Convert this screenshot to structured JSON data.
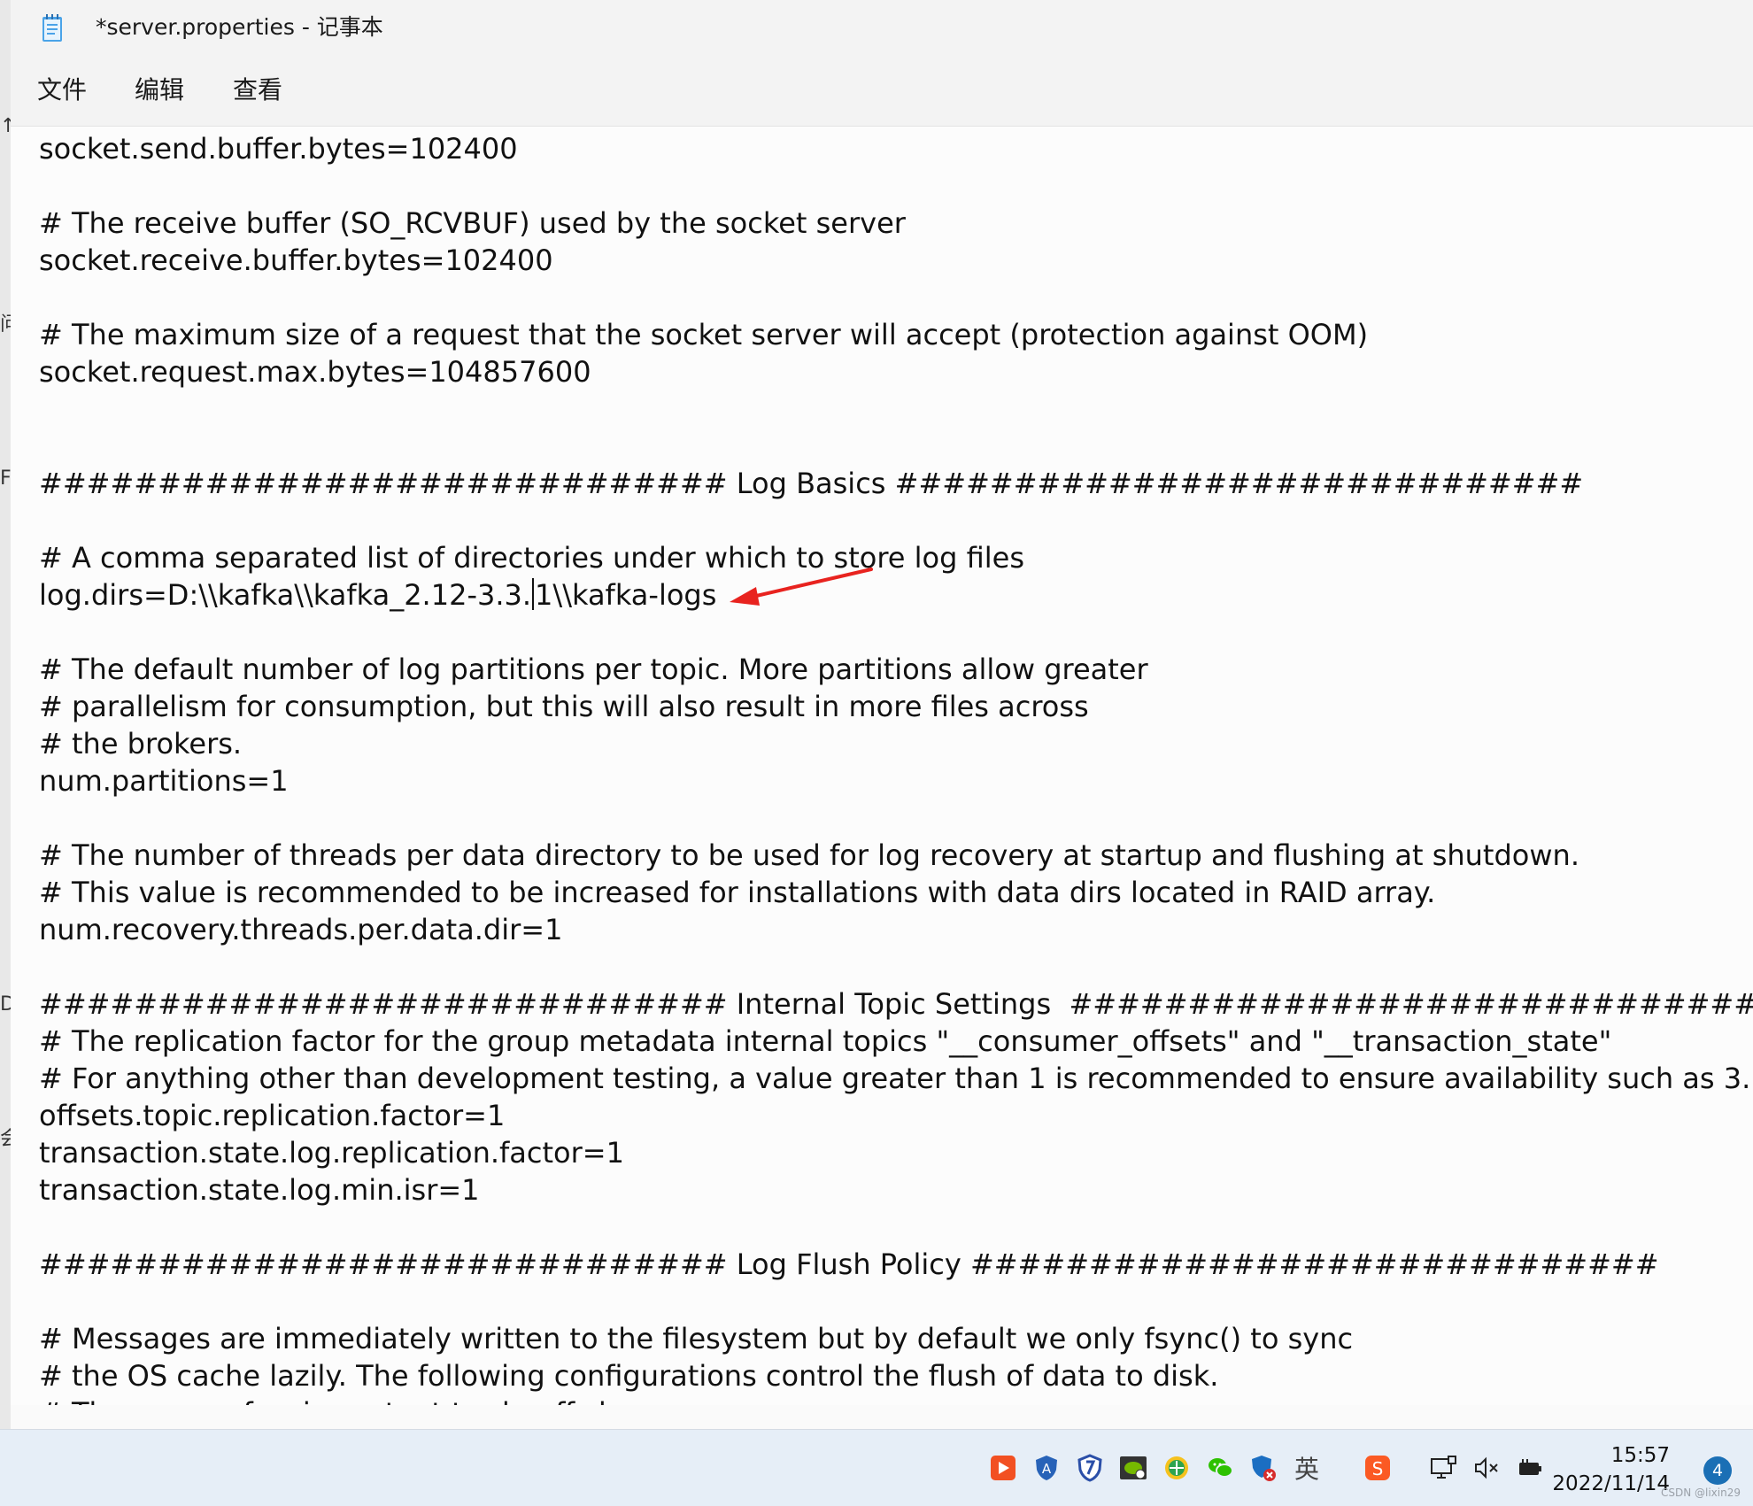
{
  "window": {
    "title": "*server.properties - 记事本"
  },
  "menu": {
    "file": "文件",
    "edit": "编辑",
    "view": "查看"
  },
  "left_strip": {
    "chars": [
      "↑",
      "问",
      "F",
      "D",
      "会"
    ]
  },
  "editor": {
    "lines": [
      "socket.send.buffer.bytes=102400",
      "",
      "# The receive buffer (SO_RCVBUF) used by the socket server",
      "socket.receive.buffer.bytes=102400",
      "",
      "# The maximum size of a request that the socket server will accept (protection against OOM)",
      "socket.request.max.bytes=104857600",
      "",
      "",
      "############################# Log Basics #############################",
      "",
      "# A comma separated list of directories under which to store log files",
      "",
      "",
      "# The default number of log partitions per topic. More partitions allow greater",
      "# parallelism for consumption, but this will also result in more files across",
      "# the brokers.",
      "num.partitions=1",
      "",
      "# The number of threads per data directory to be used for log recovery at startup and flushing at shutdown.",
      "# This value is recommended to be increased for installations with data dirs located in RAID array.",
      "num.recovery.threads.per.data.dir=1",
      "",
      "############################# Internal Topic Settings  #############################",
      "# The replication factor for the group metadata internal topics \"__consumer_offsets\" and \"__transaction_state\"",
      "# For anything other than development testing, a value greater than 1 is recommended to ensure availability such as 3.",
      "offsets.topic.replication.factor=1",
      "transaction.state.log.replication.factor=1",
      "transaction.state.log.min.isr=1",
      "",
      "############################# Log Flush Policy #############################",
      "",
      "# Messages are immediately written to the filesystem but by default we only fsync() to sync",
      "# the OS cache lazily. The following configurations control the flush of data to disk.",
      "# There are a few important trade-offs here:"
    ],
    "log_dirs_before_caret": "log.dirs=D:\\\\kafka\\\\kafka_2.12-3.3.",
    "log_dirs_after_caret": "1\\\\kafka-logs"
  },
  "annotation": {
    "arrow_color": "#e8231f"
  },
  "taskbar": {
    "ime": "英",
    "time": "15:57",
    "date": "2022/11/14",
    "notification_count": "4",
    "watermark": "CSDN @lixin29"
  },
  "colors": {
    "text": "#111111",
    "editor_bg": "#fcfcfc",
    "chrome_bg": "#f3f3f3",
    "taskbar_bg": "#e6eef7"
  }
}
